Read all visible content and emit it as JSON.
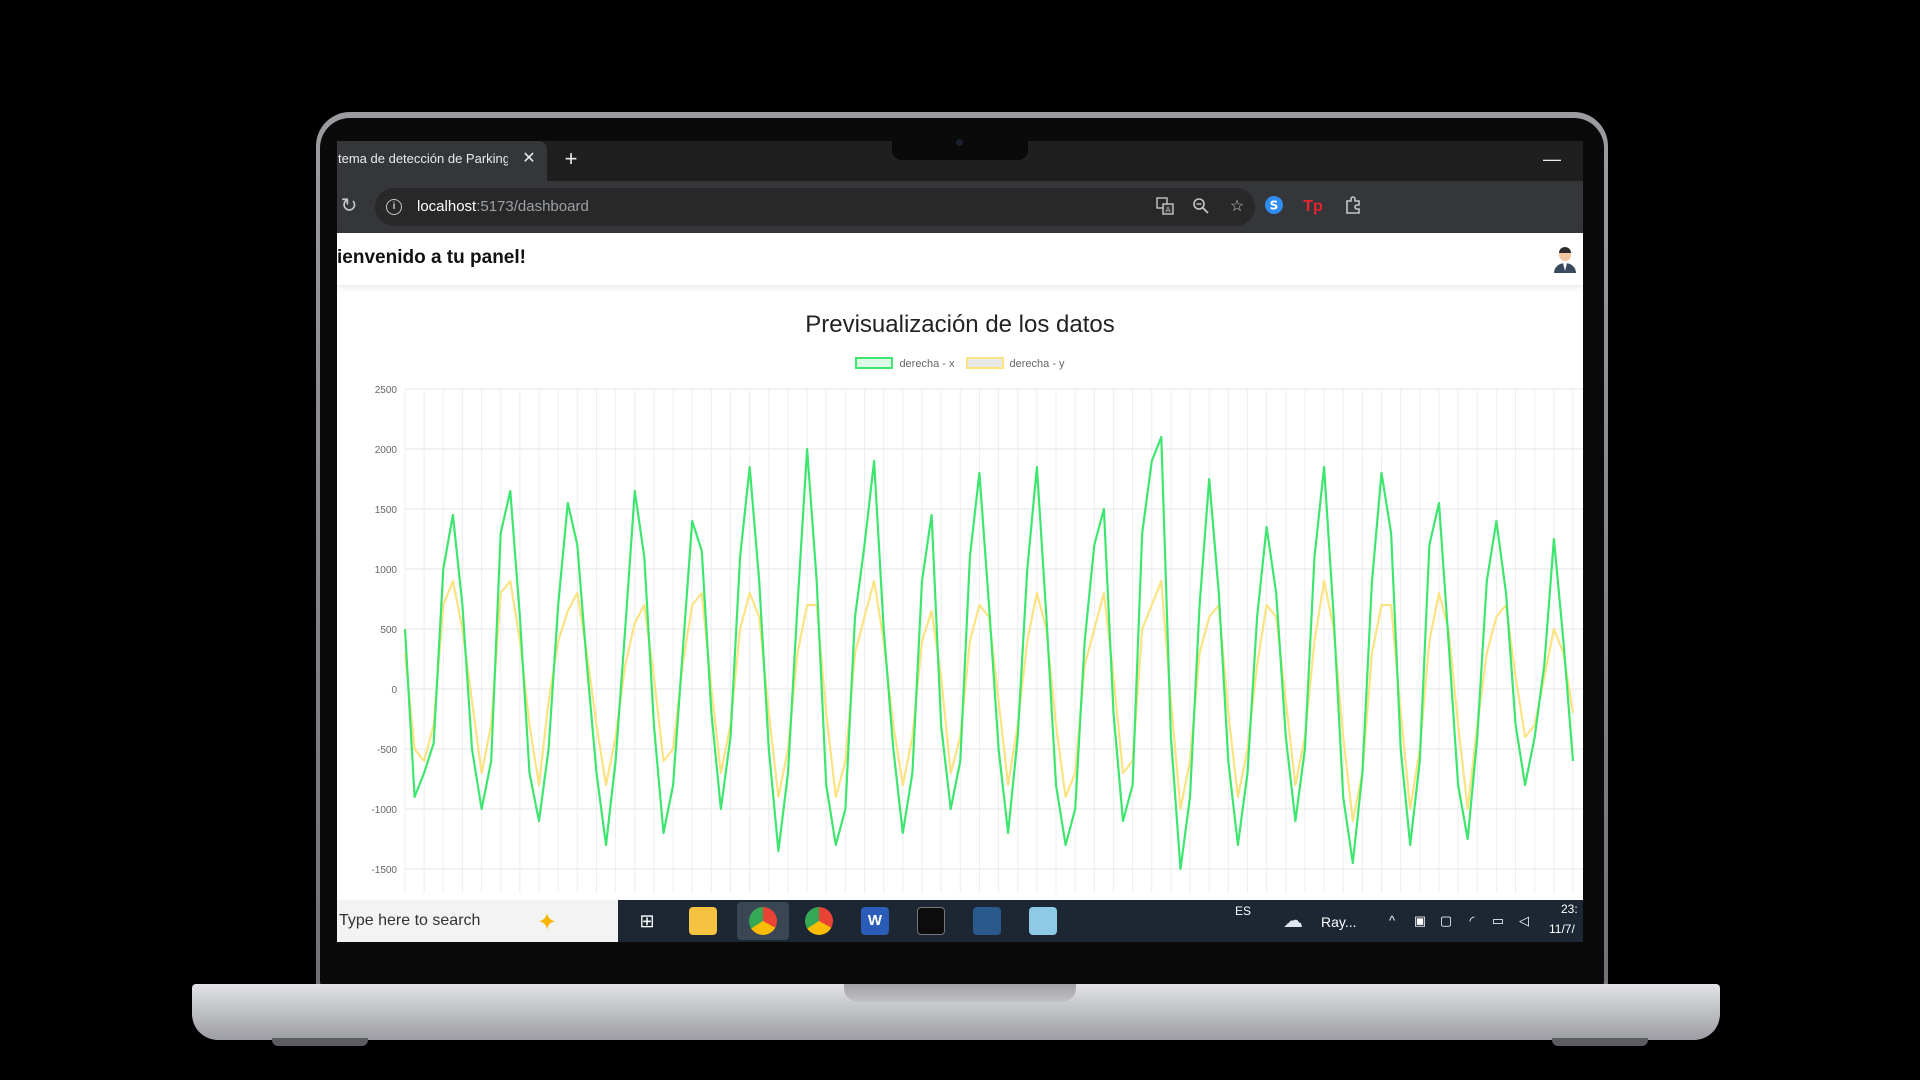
{
  "browser": {
    "tab_title": "tema de detección de Parking",
    "close_glyph": "✕",
    "newtab_glyph": "+",
    "minimize_glyph": "—",
    "url_host": "localhost",
    "url_path": ":5173/dashboard",
    "icons": [
      "reload-icon",
      "info-icon",
      "translate-icon",
      "zoom-icon",
      "bookmark-star-icon",
      "extension-s-icon",
      "extension-tp-icon",
      "extensions-puzzle-icon"
    ],
    "ext_tp_label": "Tp",
    "ext_s_label": "S"
  },
  "header": {
    "welcome": "ienvenido a tu panel!"
  },
  "taskbar": {
    "search_placeholder": "Type here to search",
    "language": "ES",
    "weather_label": "Ray...",
    "time": "23:",
    "date": "11/7/"
  },
  "colors": {
    "series_x": "#3ee66f",
    "series_y": "#fbe382",
    "taskbar": "#1c2733"
  },
  "chart_data": {
    "type": "line",
    "title": "Previsualización de los datos",
    "ylim": [
      -1700,
      2500
    ],
    "yticks": [
      2500,
      2000,
      1500,
      1000,
      500,
      0,
      -500,
      -1000,
      -1500
    ],
    "grid": true,
    "legend_position": "top",
    "series": [
      {
        "name": "derecha - x",
        "values": [
          500,
          -900,
          -700,
          -450,
          1000,
          1450,
          700,
          -500,
          -1000,
          -600,
          1300,
          1650,
          600,
          -700,
          -1100,
          -500,
          700,
          1550,
          1200,
          200,
          -700,
          -1300,
          -600,
          500,
          1650,
          1100,
          -300,
          -1200,
          -800,
          300,
          1400,
          1150,
          -200,
          -1000,
          -400,
          1100,
          1850,
          900,
          -500,
          -1350,
          -700,
          700,
          2000,
          900,
          -800,
          -1300,
          -1000,
          600,
          1200,
          1900,
          500,
          -500,
          -1200,
          -700,
          900,
          1450,
          -300,
          -1000,
          -600,
          1100,
          1800,
          700,
          -500,
          -1200,
          -400,
          1000,
          1850,
          600,
          -800,
          -1300,
          -1000,
          400,
          1200,
          1500,
          -200,
          -1100,
          -800,
          1300,
          1900,
          2100,
          -400,
          -1500,
          -900,
          700,
          1750,
          800,
          -600,
          -1300,
          -700,
          600,
          1350,
          800,
          -400,
          -1100,
          -500,
          1100,
          1850,
          600,
          -900,
          -1450,
          -700,
          900,
          1800,
          1300,
          -500,
          -1300,
          -600,
          1200,
          1550,
          400,
          -800,
          -1250,
          -400,
          900,
          1400,
          800,
          -300,
          -800,
          -400,
          200,
          1250,
          400,
          -600
        ]
      },
      {
        "name": "derecha - y",
        "values": [
          300,
          -500,
          -600,
          -300,
          700,
          900,
          500,
          -100,
          -700,
          -300,
          800,
          900,
          400,
          -300,
          -800,
          -100,
          400,
          650,
          800,
          300,
          -300,
          -800,
          -400,
          200,
          550,
          700,
          100,
          -600,
          -500,
          200,
          700,
          800,
          0,
          -700,
          -300,
          500,
          800,
          600,
          -200,
          -900,
          -500,
          300,
          700,
          700,
          -200,
          -900,
          -600,
          300,
          600,
          900,
          400,
          -300,
          -800,
          -400,
          400,
          650,
          100,
          -700,
          -400,
          400,
          700,
          600,
          -100,
          -800,
          -300,
          400,
          800,
          500,
          -300,
          -900,
          -700,
          200,
          500,
          800,
          100,
          -700,
          -600,
          500,
          700,
          900,
          -100,
          -1000,
          -600,
          300,
          600,
          700,
          -200,
          -900,
          -500,
          200,
          700,
          600,
          -100,
          -800,
          -400,
          400,
          900,
          500,
          -400,
          -1100,
          -700,
          300,
          700,
          700,
          -200,
          -1000,
          -500,
          400,
          800,
          500,
          -300,
          -1000,
          -300,
          300,
          600,
          700,
          100,
          -400,
          -300,
          100,
          500,
          300,
          -200
        ]
      }
    ]
  }
}
